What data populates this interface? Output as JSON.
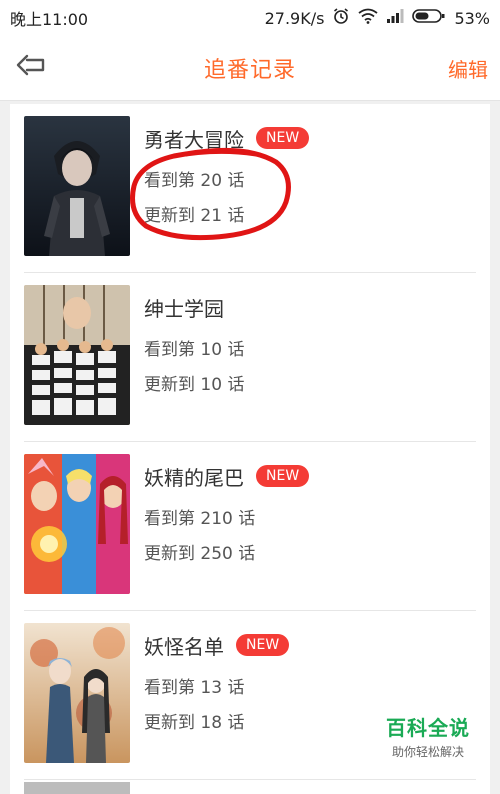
{
  "status": {
    "time": "晚上11:00",
    "speed": "27.9K/s",
    "battery": "53%",
    "icons": [
      "alarm-icon",
      "wifi-icon",
      "signal-icon",
      "battery-icon"
    ]
  },
  "header": {
    "title": "追番记录",
    "edit_label": "编辑",
    "back_icon": "back-arrow-icon"
  },
  "items": [
    {
      "title": "勇者大冒险",
      "badge": "NEW",
      "watched": "看到第 20 话",
      "updated": "更新到 21 话"
    },
    {
      "title": "绅士学园",
      "badge": "",
      "watched": "看到第 10 话",
      "updated": "更新到 10 话"
    },
    {
      "title": "妖精的尾巴",
      "badge": "NEW",
      "watched": "看到第 210 话",
      "updated": "更新到 250 话"
    },
    {
      "title": "妖怪名单",
      "badge": "NEW",
      "watched": "看到第 13 话",
      "updated": "更新到 18 话"
    }
  ],
  "watermark": {
    "main": "百科全说",
    "sub": "助你轻松解决"
  },
  "colors": {
    "accent": "#ff6a2b",
    "badge": "#f43b35",
    "watermark": "#1aaa55"
  }
}
